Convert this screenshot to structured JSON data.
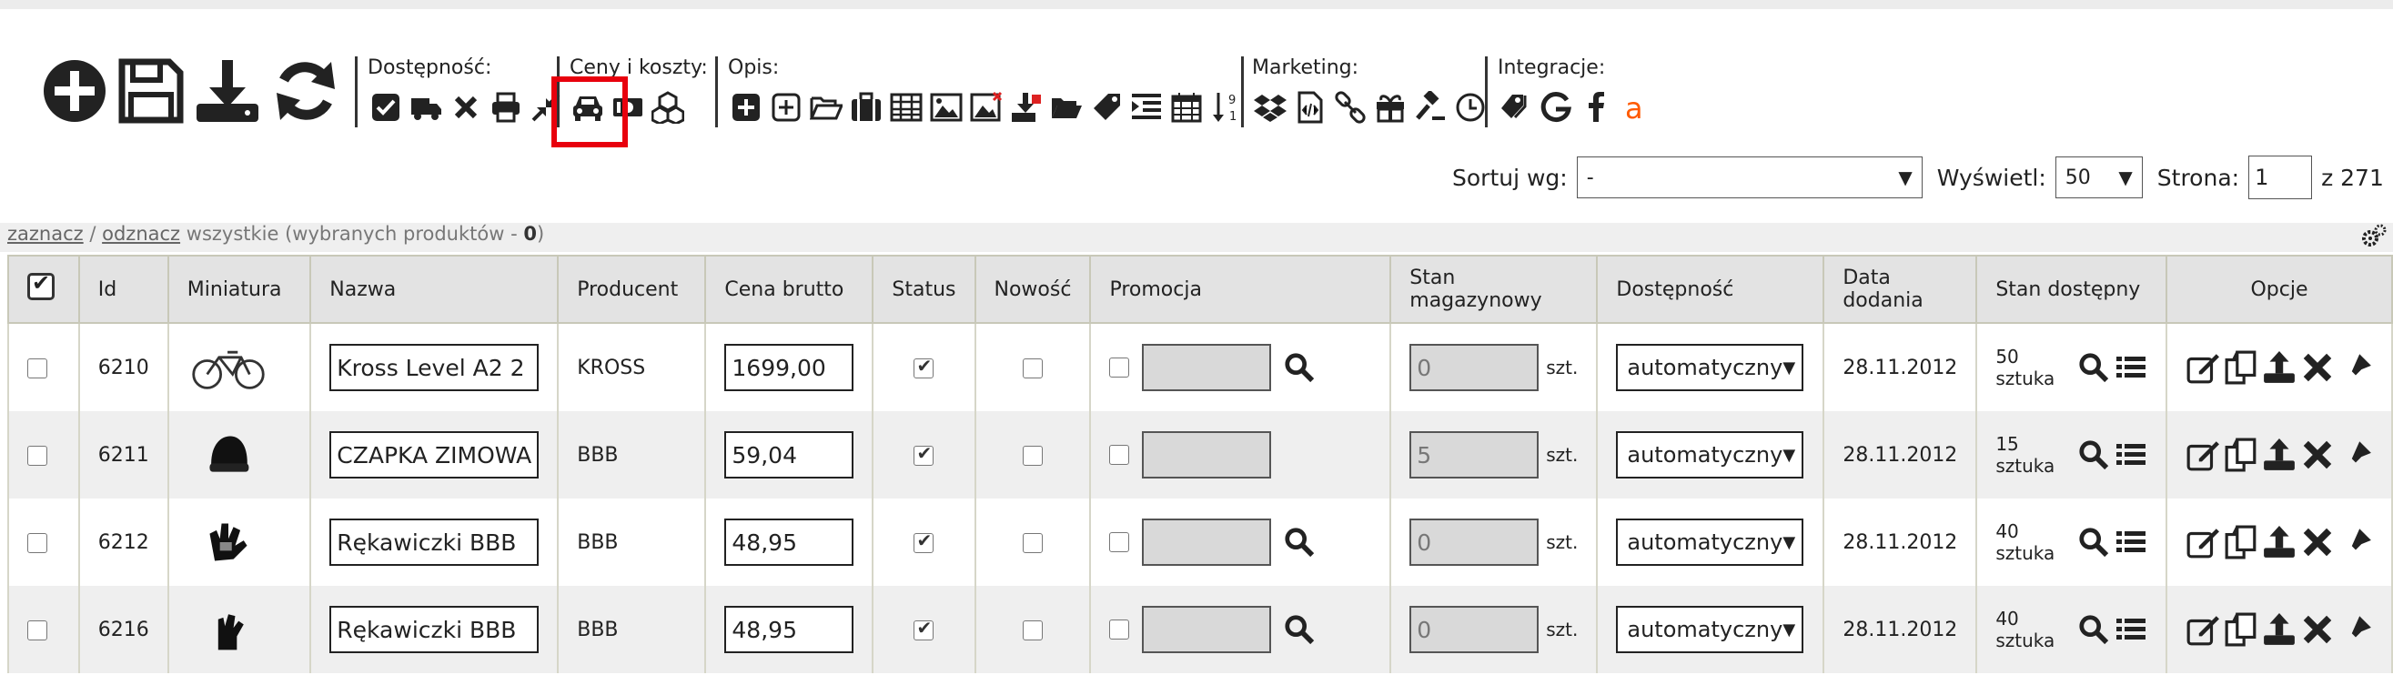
{
  "toolbar": {
    "main_icons": [
      "add-icon",
      "save-icon",
      "download-icon",
      "refresh-icon"
    ],
    "groups": {
      "availability": {
        "label": "Dostępność:"
      },
      "prices": {
        "label": "Ceny i koszty:"
      },
      "description": {
        "label": "Opis:"
      },
      "marketing": {
        "label": "Marketing:"
      },
      "integrations": {
        "label": "Integracje:"
      }
    },
    "highlight_color": "#e8000d"
  },
  "sortbar": {
    "sort_label": "Sortuj wg:",
    "sort_value": "-",
    "show_label": "Wyświetl:",
    "show_value": "50",
    "page_label": "Strona:",
    "page_value": "1",
    "page_total": "z 271"
  },
  "selection": {
    "select_link": "zaznacz",
    "slash": "/",
    "deselect_link": "odznacz",
    "rest_text": "wszystkie (wybranych produktów - ",
    "count": "0",
    "close": ")"
  },
  "table": {
    "headers": {
      "id": "Id",
      "thumb": "Miniatura",
      "name": "Nazwa",
      "producer": "Producent",
      "price": "Cena brutto",
      "status": "Status",
      "new": "Nowość",
      "promo": "Promocja",
      "stock": "Stan magazynowy",
      "avail": "Dostępność",
      "date": "Data dodania",
      "stock_avail": "Stan dostępny",
      "options": "Opcje"
    },
    "unit": "szt.",
    "rows": [
      {
        "id": "6210",
        "thumb": "bike",
        "name": "Kross Level A2 2",
        "producer": "KROSS",
        "price": "1699,00",
        "status": true,
        "new": false,
        "promo_search": true,
        "stock": "0",
        "avail": "automatyczny",
        "date": "28.11.2012",
        "stock_avail": "50 sztuka"
      },
      {
        "id": "6211",
        "thumb": "cap",
        "name": "CZAPKA ZIMOWA",
        "producer": "BBB",
        "price": "59,04",
        "status": true,
        "new": false,
        "promo_search": false,
        "stock": "5",
        "avail": "automatyczny",
        "date": "28.11.2012",
        "stock_avail": "15 sztuka"
      },
      {
        "id": "6212",
        "thumb": "gloves",
        "name": "Rękawiczki BBB",
        "producer": "BBB",
        "price": "48,95",
        "status": true,
        "new": false,
        "promo_search": true,
        "stock": "0",
        "avail": "automatyczny",
        "date": "28.11.2012",
        "stock_avail": "40 sztuka"
      },
      {
        "id": "6216",
        "thumb": "glove",
        "name": "Rękawiczki BBB",
        "producer": "BBB",
        "price": "48,95",
        "status": true,
        "new": false,
        "promo_search": true,
        "stock": "0",
        "avail": "automatyczny",
        "date": "28.11.2012",
        "stock_avail": "40 sztuka"
      }
    ]
  }
}
